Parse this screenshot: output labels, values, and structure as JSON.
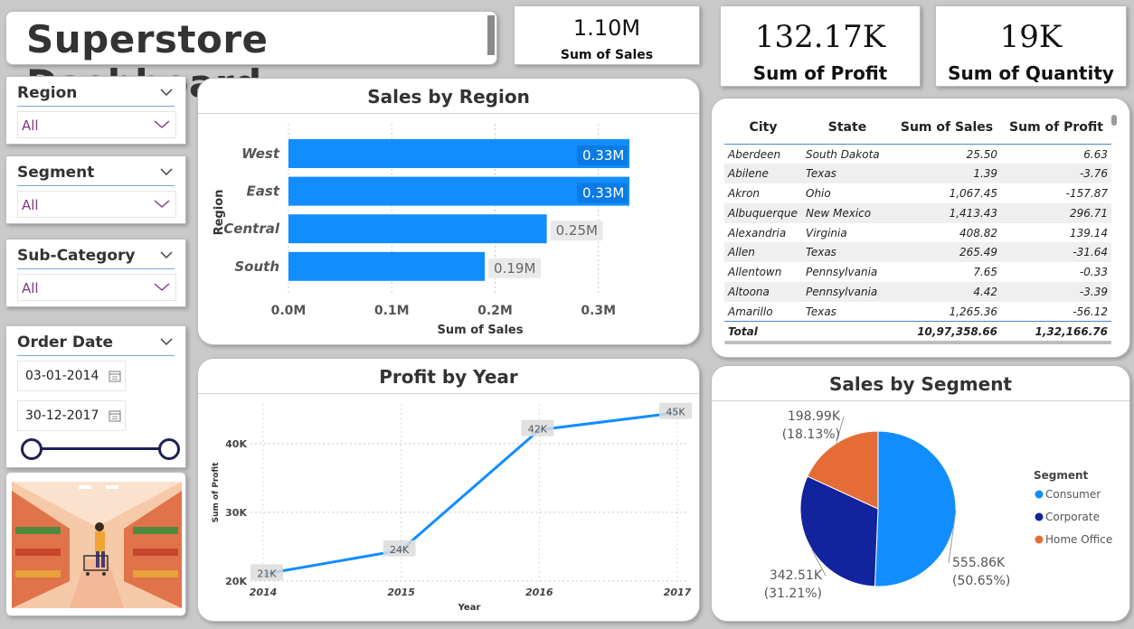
{
  "header": {
    "title": "Superstore Dashboard"
  },
  "kpis": {
    "sales": {
      "value": "1.10M",
      "label": "Sum of Sales"
    },
    "profit": {
      "value": "132.17K",
      "label": "Sum of Profit"
    },
    "quantity": {
      "value": "19K",
      "label": "Sum of Quantity"
    }
  },
  "slicers": {
    "region": {
      "title": "Region",
      "value": "All"
    },
    "segment": {
      "title": "Segment",
      "value": "All"
    },
    "subcategory": {
      "title": "Sub-Category",
      "value": "All"
    },
    "order_date": {
      "title": "Order Date",
      "start": "03-01-2014",
      "end": "30-12-2017"
    }
  },
  "colors": {
    "bar": "#118dff",
    "line": "#118dff",
    "consumer": "#118dff",
    "corporate": "#12239e",
    "home_office": "#e66c37"
  },
  "table": {
    "columns": [
      "City",
      "State",
      "Sum of Sales",
      "Sum of Profit"
    ],
    "rows": [
      [
        "Aberdeen",
        "South Dakota",
        "25.50",
        "6.63"
      ],
      [
        "Abilene",
        "Texas",
        "1.39",
        "-3.76"
      ],
      [
        "Akron",
        "Ohio",
        "1,067.45",
        "-157.87"
      ],
      [
        "Albuquerque",
        "New Mexico",
        "1,413.43",
        "296.71"
      ],
      [
        "Alexandria",
        "Virginia",
        "408.82",
        "139.14"
      ],
      [
        "Allen",
        "Texas",
        "265.49",
        "-31.64"
      ],
      [
        "Allentown",
        "Pennsylvania",
        "7.65",
        "-0.33"
      ],
      [
        "Altoona",
        "Pennsylvania",
        "4.42",
        "-3.39"
      ],
      [
        "Amarillo",
        "Texas",
        "1,265.36",
        "-56.12"
      ]
    ],
    "total": [
      "Total",
      "",
      "10,97,358.66",
      "1,32,166.76"
    ]
  },
  "chart_data": [
    {
      "id": "sales_by_region",
      "type": "bar",
      "orientation": "horizontal",
      "title": "Sales by Region",
      "xlabel": "Sum of Sales",
      "ylabel": "Region",
      "categories": [
        "West",
        "East",
        "Central",
        "South"
      ],
      "values": [
        0.33,
        0.33,
        0.25,
        0.19
      ],
      "data_labels": [
        "0.33M",
        "0.33M",
        "0.25M",
        "0.19M"
      ],
      "xlim": [
        0,
        0.33
      ],
      "xticks": [
        0,
        0.1,
        0.2,
        0.3
      ],
      "xtick_labels": [
        "0.0M",
        "0.1M",
        "0.2M",
        "0.3M"
      ]
    },
    {
      "id": "profit_by_year",
      "type": "line",
      "title": "Profit by Year",
      "xlabel": "Year",
      "ylabel": "Sum of Profit",
      "x": [
        2014,
        2015,
        2016,
        2017
      ],
      "values": [
        21,
        24.5,
        42,
        44.5
      ],
      "data_labels": [
        "21K",
        "24K",
        "42K",
        "45K"
      ],
      "ylim": [
        20,
        45.5
      ],
      "yticks": [
        20,
        30,
        40
      ],
      "ytick_labels": [
        "20K",
        "30K",
        "40K"
      ]
    },
    {
      "id": "sales_by_segment",
      "type": "pie",
      "title": "Sales by Segment",
      "legend_title": "Segment",
      "legend_position": "right",
      "categories": [
        "Consumer",
        "Corporate",
        "Home Office"
      ],
      "values": [
        555.86,
        342.51,
        198.99
      ],
      "labels": [
        "555.86K",
        "342.51K",
        "198.99K"
      ],
      "percents": [
        "(50.65%)",
        "(31.21%)",
        "(18.13%)"
      ]
    }
  ]
}
